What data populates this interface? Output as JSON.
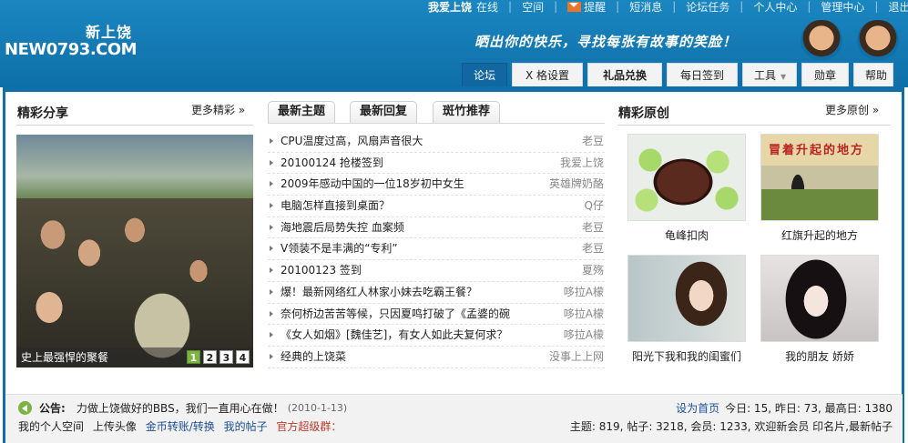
{
  "header": {
    "logo_cn": "新上饶",
    "logo_en": "NEW0793.COM",
    "slogan": "晒出你的快乐，寻找每张有故事的笑脸！",
    "top_links": {
      "username": "我爱上饶",
      "online": "在线",
      "space": "空间",
      "remind": "提醒",
      "sms": "短消息",
      "tasks": "论坛任务",
      "profile": "个人中心",
      "admin": "管理中心",
      "logout": "退出"
    },
    "nav": {
      "forum": "论坛",
      "xge": "X 格设置",
      "shop": "礼品兑换",
      "sign": "每日签到",
      "tools": "工具",
      "medal": "勋章",
      "help": "帮助"
    }
  },
  "left": {
    "title": "精彩分享",
    "more": "更多精彩 »",
    "caption": "史上最强悍的聚餐",
    "pages": [
      "1",
      "2",
      "3",
      "4"
    ]
  },
  "middle": {
    "tabs": [
      "最新主题",
      "最新回复",
      "斑竹推荐"
    ],
    "topics": [
      {
        "title": "CPU温度过高，风扇声音很大",
        "author": "老豆"
      },
      {
        "title": "20100124 抢楼签到",
        "author": "我爱上饶"
      },
      {
        "title": "2009年感动中国的一位18岁初中女生",
        "author": "英雄牌奶酪"
      },
      {
        "title": "电脑怎样直接到桌面？",
        "author": "Q仔"
      },
      {
        "title": "海地震后局势失控 血案频",
        "author": "老豆"
      },
      {
        "title": "V领装不是丰满的“专利”",
        "author": "老豆"
      },
      {
        "title": "20100123 签到",
        "author": "夏殇"
      },
      {
        "title": "爆！最新网络红人林家小妹去吃霸王餐？",
        "author": "哆拉A檬"
      },
      {
        "title": "奈何桥边苦苦等候，只因夏鸣打破了《孟婆的碗",
        "author": "哆拉A檬"
      },
      {
        "title": "《女人如烟》[魏佳艺]，有女人如此夫复何求？",
        "author": "哆拉A檬"
      },
      {
        "title": "经典的上饶菜",
        "author": "没事上上网"
      }
    ]
  },
  "right": {
    "title": "精彩原创",
    "more": "更多原创 »",
    "flag_sign": "冒着升起的地方",
    "captions": [
      "龟峰扣肉",
      "红旗升起的地方",
      "阳光下我和我的闺蜜们",
      "我的朋友 娇娇"
    ]
  },
  "bottom": {
    "announce_label": "公告:",
    "announce_text": "力做上饶做好的BBS，我们一直用心在做！",
    "announce_date": "(2010-1-13)",
    "homepage_link": "设为首页",
    "stats_line1": "今日: 15, 昨日: 73, 最高日: 1380",
    "link_space": "我的个人空间",
    "link_avatar": "上传头像",
    "link_coin": "金币转账/转换",
    "link_posts": "我的帖子",
    "link_qq": "官方超级群：",
    "stats_line2": "主题: 819, 帖子: 3218, 会员: 1233, 欢迎新会员 印名片,最新帖子"
  }
}
